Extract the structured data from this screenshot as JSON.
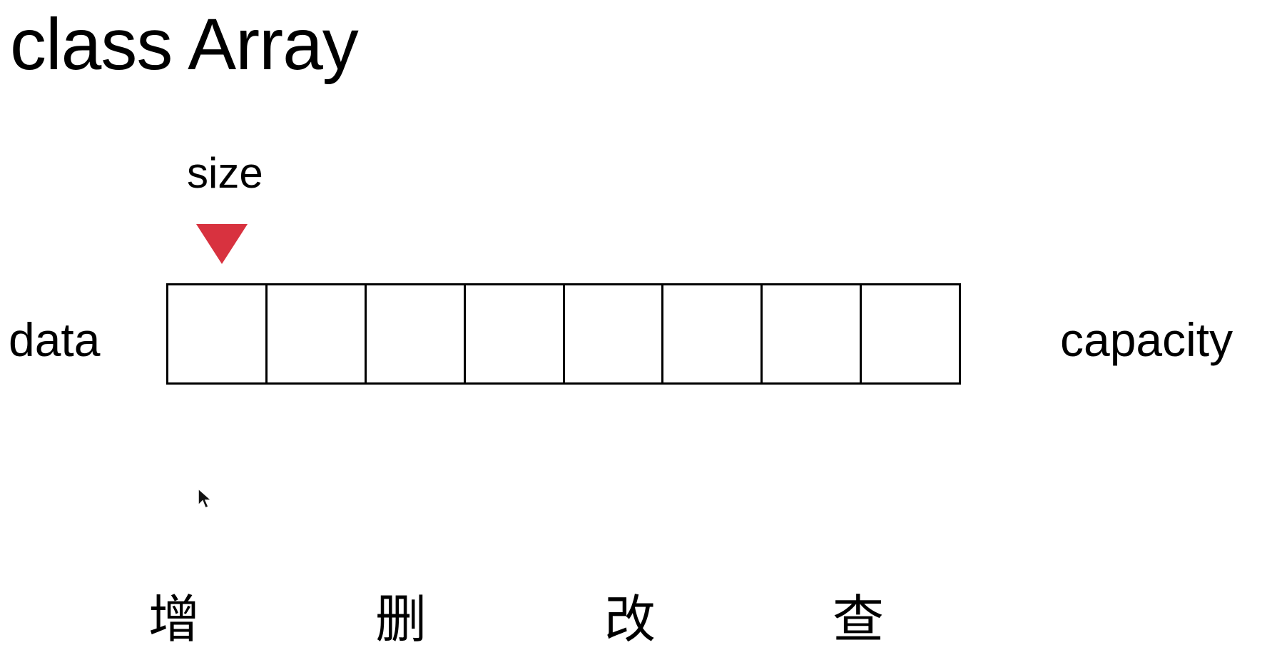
{
  "slide": {
    "title": "class Array",
    "pointer_label": "size",
    "array_label": "data",
    "capacity_label": "capacity",
    "cell_count": 8,
    "operations": [
      "增",
      "删",
      "改",
      "查"
    ]
  },
  "colors": {
    "pointer": "#d8323f",
    "cell_border": "#000000",
    "background": "#ffffff"
  },
  "icons": {
    "pointer": "triangle-down-icon",
    "cursor": "mouse-cursor-icon"
  }
}
